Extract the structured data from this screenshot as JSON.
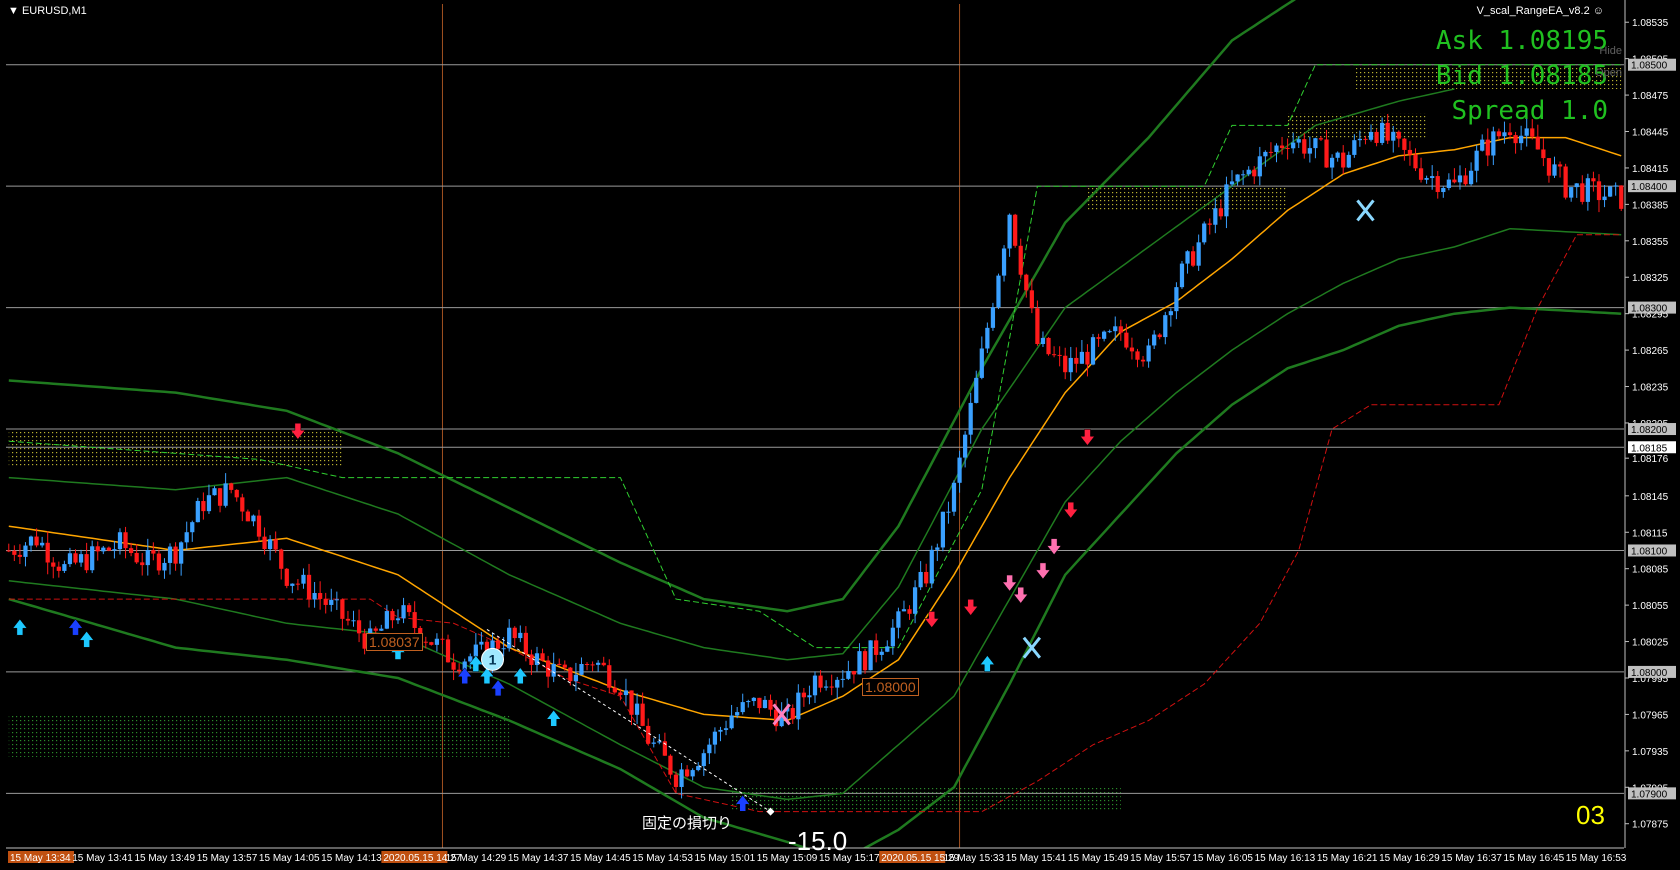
{
  "window": {
    "symbol": "EURUSD,M1",
    "ea_name": "V_scal_RangeEA_v8.2",
    "menu_icon": "triangle-down-icon",
    "smile_icon": "smiley-icon"
  },
  "quotes": {
    "ask": "Ask 1.08195",
    "bid": "Bid 1.08185",
    "spread": "Spread 1.0",
    "hide": "Hide",
    "open": "Open"
  },
  "annotations": {
    "stop_loss_label": "固定の損切り",
    "pips_result": "-15.0",
    "counter": "03",
    "trade_number": "1",
    "price_box_1": "1.08037",
    "price_box_2": "1.08000"
  },
  "colors": {
    "bull": "#3aa0ff",
    "bear": "#ff1a1a",
    "ma": "#ffa500",
    "band": "#1f7a1f",
    "grid": "#9a9a9a",
    "vline": "#a05020",
    "quote": "#20c020",
    "counter": "#ffff00"
  },
  "chart_data": {
    "type": "candlestick",
    "symbol": "EURUSD",
    "timeframe": "M1",
    "ylim": [
      1.07855,
      1.0855
    ],
    "y_ticks": [
      "1.08535",
      "1.08505",
      "1.08475",
      "1.08445",
      "1.08415",
      "1.08385",
      "1.08355",
      "1.08325",
      "1.08295",
      "1.08265",
      "1.08235",
      "1.08205",
      "1.08176",
      "1.08145",
      "1.08115",
      "1.08085",
      "1.08055",
      "1.08025",
      "1.07995",
      "1.07965",
      "1.07935",
      "1.07905",
      "1.07875"
    ],
    "highlighted_levels": [
      {
        "label": "1.08500",
        "value": 1.085
      },
      {
        "label": "1.08400",
        "value": 1.084
      },
      {
        "label": "1.08300",
        "value": 1.083
      },
      {
        "label": "1.08200",
        "value": 1.082
      },
      {
        "label": "1.08185",
        "value": 1.08185
      },
      {
        "label": "1.08100",
        "value": 1.081
      },
      {
        "label": "1.08000",
        "value": 1.08
      },
      {
        "label": "1.07900",
        "value": 1.079
      }
    ],
    "x_labels": [
      "15 May 13:34",
      "15 May 13:41",
      "15 May 13:49",
      "15 May 13:57",
      "15 May 14:05",
      "15 May 14:13",
      "2020.05.15 14:27",
      "15 May 14:29",
      "15 May 14:37",
      "15 May 14:45",
      "15 May 14:53",
      "15 May 15:01",
      "15 May 15:09",
      "15 May 15:17",
      "2020.05.15 15:29",
      "15 May 15:33",
      "15 May 15:41",
      "15 May 15:49",
      "15 May 15:57",
      "15 May 16:05",
      "15 May 16:13",
      "15 May 16:21",
      "15 May 16:29",
      "15 May 16:37",
      "15 May 16:45",
      "15 May 16:53"
    ],
    "x_label_highlight": [
      true,
      false,
      false,
      false,
      false,
      false,
      true,
      false,
      false,
      false,
      false,
      false,
      false,
      false,
      true,
      false,
      false,
      false,
      false,
      false,
      false,
      false,
      false,
      false,
      false,
      false
    ],
    "close_anchors": [
      [
        0,
        1.081
      ],
      [
        5,
        1.0811
      ],
      [
        10,
        1.08085
      ],
      [
        15,
        1.08095
      ],
      [
        20,
        1.08105
      ],
      [
        25,
        1.0809
      ],
      [
        30,
        1.081
      ],
      [
        35,
        1.0814
      ],
      [
        40,
        1.0815
      ],
      [
        45,
        1.0812
      ],
      [
        50,
        1.0808
      ],
      [
        55,
        1.08065
      ],
      [
        60,
        1.08045
      ],
      [
        65,
        1.08025
      ],
      [
        70,
        1.0805
      ],
      [
        75,
        1.0803
      ],
      [
        80,
        1.0801
      ],
      [
        85,
        1.08015
      ],
      [
        90,
        1.0803
      ],
      [
        95,
        1.0801
      ],
      [
        100,
        1.07995
      ],
      [
        105,
        1.0801
      ],
      [
        110,
        1.0799
      ],
      [
        115,
        1.07945
      ],
      [
        120,
        1.07915
      ],
      [
        125,
        1.07935
      ],
      [
        130,
        1.07965
      ],
      [
        135,
        1.07975
      ],
      [
        140,
        1.0796
      ],
      [
        145,
        1.07995
      ],
      [
        150,
        1.08
      ],
      [
        155,
        1.08015
      ],
      [
        160,
        1.0804
      ],
      [
        165,
        1.0808
      ],
      [
        170,
        1.0815
      ],
      [
        175,
        1.0826
      ],
      [
        180,
        1.0838
      ],
      [
        185,
        1.0827
      ],
      [
        190,
        1.0825
      ],
      [
        195,
        1.08265
      ],
      [
        200,
        1.0828
      ],
      [
        205,
        1.0826
      ],
      [
        210,
        1.0832
      ],
      [
        215,
        1.0836
      ],
      [
        220,
        1.084
      ],
      [
        225,
        1.0842
      ],
      [
        230,
        1.0844
      ],
      [
        235,
        1.0843
      ],
      [
        240,
        1.0842
      ],
      [
        245,
        1.0845
      ],
      [
        250,
        1.0843
      ],
      [
        255,
        1.0841
      ],
      [
        260,
        1.084
      ],
      [
        265,
        1.0843
      ],
      [
        270,
        1.0845
      ],
      [
        275,
        1.0843
      ],
      [
        280,
        1.084
      ],
      [
        285,
        1.08395
      ],
      [
        290,
        1.0839
      ]
    ],
    "ma_anchors": [
      [
        0,
        1.0812
      ],
      [
        30,
        1.081
      ],
      [
        50,
        1.0811
      ],
      [
        70,
        1.0808
      ],
      [
        90,
        1.0802
      ],
      [
        110,
        1.07985
      ],
      [
        125,
        1.07965
      ],
      [
        140,
        1.0796
      ],
      [
        150,
        1.0798
      ],
      [
        160,
        1.0801
      ],
      [
        170,
        1.0808
      ],
      [
        180,
        1.0816
      ],
      [
        190,
        1.0823
      ],
      [
        200,
        1.0828
      ],
      [
        210,
        1.08305
      ],
      [
        220,
        1.0834
      ],
      [
        230,
        1.0838
      ],
      [
        240,
        1.0841
      ],
      [
        250,
        1.08425
      ],
      [
        260,
        1.0843
      ],
      [
        270,
        1.0844
      ],
      [
        280,
        1.0844
      ],
      [
        290,
        1.08425
      ]
    ],
    "outer_upper_band": [
      [
        0,
        1.0824
      ],
      [
        30,
        1.0823
      ],
      [
        50,
        1.08215
      ],
      [
        70,
        1.0818
      ],
      [
        90,
        1.08135
      ],
      [
        110,
        1.0809
      ],
      [
        125,
        1.0806
      ],
      [
        140,
        1.0805
      ],
      [
        150,
        1.0806
      ],
      [
        160,
        1.0812
      ],
      [
        175,
        1.0825
      ],
      [
        190,
        1.0837
      ],
      [
        205,
        1.0844
      ],
      [
        220,
        1.0852
      ],
      [
        235,
        1.08565
      ]
    ],
    "inner_upper_band": [
      [
        0,
        1.0816
      ],
      [
        30,
        1.0815
      ],
      [
        50,
        1.0816
      ],
      [
        70,
        1.0813
      ],
      [
        90,
        1.0808
      ],
      [
        110,
        1.0804
      ],
      [
        125,
        1.0802
      ],
      [
        140,
        1.0801
      ],
      [
        150,
        1.08015
      ],
      [
        160,
        1.0807
      ],
      [
        175,
        1.082
      ],
      [
        190,
        1.083
      ],
      [
        205,
        1.0835
      ],
      [
        220,
        1.084
      ],
      [
        235,
        1.0845
      ],
      [
        250,
        1.0847
      ],
      [
        260,
        1.0848
      ]
    ],
    "inner_lower_band": [
      [
        0,
        1.08075
      ],
      [
        30,
        1.0806
      ],
      [
        50,
        1.0804
      ],
      [
        70,
        1.0803
      ],
      [
        90,
        1.0799
      ],
      [
        110,
        1.0794
      ],
      [
        125,
        1.07905
      ],
      [
        140,
        1.07895
      ],
      [
        150,
        1.079
      ],
      [
        160,
        1.0794
      ],
      [
        170,
        1.0798
      ],
      [
        180,
        1.0806
      ],
      [
        190,
        1.0814
      ],
      [
        200,
        1.0819
      ],
      [
        210,
        1.0823
      ],
      [
        220,
        1.08265
      ],
      [
        230,
        1.08295
      ],
      [
        240,
        1.0832
      ],
      [
        250,
        1.0834
      ],
      [
        260,
        1.0835
      ],
      [
        270,
        1.08365
      ],
      [
        290,
        1.0836
      ]
    ],
    "outer_lower_band": [
      [
        0,
        1.0806
      ],
      [
        30,
        1.0802
      ],
      [
        50,
        1.0801
      ],
      [
        70,
        1.07995
      ],
      [
        90,
        1.0796
      ],
      [
        110,
        1.0792
      ],
      [
        125,
        1.0788
      ],
      [
        140,
        1.0786
      ],
      [
        150,
        1.07845
      ],
      [
        160,
        1.0787
      ],
      [
        170,
        1.07905
      ],
      [
        180,
        1.0799
      ],
      [
        190,
        1.0808
      ],
      [
        200,
        1.0813
      ],
      [
        210,
        1.0818
      ],
      [
        220,
        1.0822
      ],
      [
        230,
        1.0825
      ],
      [
        240,
        1.08265
      ],
      [
        250,
        1.08285
      ],
      [
        260,
        1.08295
      ],
      [
        270,
        1.083
      ],
      [
        290,
        1.08295
      ]
    ],
    "trailing_stop": [
      [
        0,
        1.0806
      ],
      [
        30,
        1.0806
      ],
      [
        65,
        1.0806
      ],
      [
        70,
        1.08045
      ],
      [
        80,
        1.0804
      ],
      [
        90,
        1.0802
      ],
      [
        100,
        1.07995
      ],
      [
        110,
        1.0798
      ],
      [
        120,
        1.079
      ],
      [
        135,
        1.07885
      ],
      [
        150,
        1.07885
      ],
      [
        165,
        1.07885
      ],
      [
        175,
        1.07885
      ],
      [
        185,
        1.0791
      ],
      [
        195,
        1.0794
      ],
      [
        205,
        1.0796
      ],
      [
        215,
        1.0799
      ],
      [
        225,
        1.0804
      ],
      [
        232,
        1.081
      ],
      [
        238,
        1.082
      ],
      [
        245,
        1.0822
      ],
      [
        260,
        1.0822
      ],
      [
        268,
        1.0822
      ],
      [
        275,
        1.083
      ],
      [
        282,
        1.0836
      ],
      [
        290,
        1.0836
      ]
    ],
    "resistance_green": [
      [
        0,
        1.0819
      ],
      [
        45,
        1.08175
      ],
      [
        60,
        1.0816
      ],
      [
        110,
        1.0816
      ],
      [
        115,
        1.0811
      ],
      [
        120,
        1.0806
      ],
      [
        135,
        1.0805
      ],
      [
        145,
        1.0802
      ],
      [
        155,
        1.0802
      ],
      [
        160,
        1.0802
      ],
      [
        175,
        1.0815
      ],
      [
        185,
        1.084
      ],
      [
        215,
        1.084
      ],
      [
        220,
        1.0845
      ],
      [
        230,
        1.0845
      ],
      [
        235,
        1.085
      ],
      [
        290,
        1.085
      ]
    ],
    "signals_buy": [
      [
        2,
        1.0805
      ],
      [
        12,
        1.0805
      ],
      [
        14,
        1.0804
      ],
      [
        70,
        1.0803
      ],
      [
        82,
        1.0801
      ],
      [
        84,
        1.0802
      ],
      [
        86,
        1.0801
      ],
      [
        88,
        1.08
      ],
      [
        92,
        1.0801
      ],
      [
        98,
        1.07975
      ],
      [
        132,
        1.07905
      ],
      [
        176,
        1.0802
      ]
    ],
    "signals_sell": [
      [
        52,
        1.08185
      ],
      [
        166,
        1.0803
      ],
      [
        173,
        1.0804
      ],
      [
        180,
        1.0806
      ],
      [
        182,
        1.0805
      ],
      [
        186,
        1.0807
      ],
      [
        188,
        1.0809
      ],
      [
        191,
        1.0812
      ],
      [
        194,
        1.0818
      ]
    ],
    "signals_cross": [
      [
        139,
        1.07965
      ],
      [
        184,
        1.0802
      ],
      [
        244,
        1.0838
      ]
    ],
    "trade_entry_index": 86,
    "trade_entry_price": 1.08035,
    "trade_exit_index": 137,
    "trade_exit_price": 1.07885,
    "range_zones": [
      {
        "start": 0,
        "end": 60,
        "top": 1.082,
        "bottom": 1.0817
      },
      {
        "start": 0,
        "end": 90,
        "top": 1.07965,
        "bottom": 1.0793
      },
      {
        "start": 130,
        "end": 200,
        "top": 1.07905,
        "bottom": 1.07885
      },
      {
        "start": 194,
        "end": 230,
        "top": 1.084,
        "bottom": 1.0838
      },
      {
        "start": 230,
        "end": 255,
        "top": 1.0846,
        "bottom": 1.0844
      },
      {
        "start": 242,
        "end": 290,
        "top": 1.085,
        "bottom": 1.0848
      }
    ],
    "vertical_lines_index": [
      78,
      171
    ],
    "candle_count": 291,
    "grid": false
  }
}
